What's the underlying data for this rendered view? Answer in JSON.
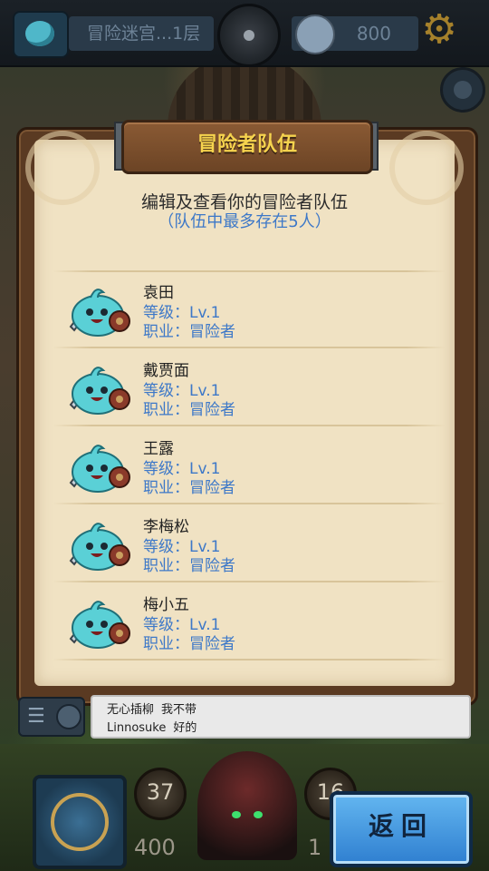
{
  "topbar": {
    "location": "冒险迷宫...1层",
    "gold": "800"
  },
  "dialog": {
    "title": "冒险者队伍",
    "subtitle": "编辑及查看你的冒险者队伍",
    "note": "（队伍中最多存在5人）"
  },
  "party": [
    {
      "name": "袁田",
      "level": "等级：Lv.1",
      "job": "职业：冒险者"
    },
    {
      "name": "戴贾面",
      "level": "等级：Lv.1",
      "job": "职业：冒险者"
    },
    {
      "name": "王露",
      "level": "等级：Lv.1",
      "job": "职业：冒险者"
    },
    {
      "name": "李梅松",
      "level": "等级：Lv.1",
      "job": "职业：冒险者"
    },
    {
      "name": "梅小五",
      "level": "等级：Lv.1",
      "job": "职业：冒险者"
    }
  ],
  "chat": [
    {
      "user": "无心插柳",
      "message": "我不带"
    },
    {
      "user": "Linnosuke",
      "message": "好的"
    }
  ],
  "hud": {
    "stat1": "37",
    "stat2": "400",
    "stat3": "16",
    "stat4": "1"
  },
  "buttons": {
    "back": "返回"
  },
  "colors": {
    "accent_blue": "#3d78c8",
    "title_gold": "#f6d34e",
    "parchment": "#f0e2c3"
  },
  "icons": {
    "settings": "gear-icon",
    "chat": "chat-menu-icon",
    "hero": "slime-adventurer-icon"
  }
}
